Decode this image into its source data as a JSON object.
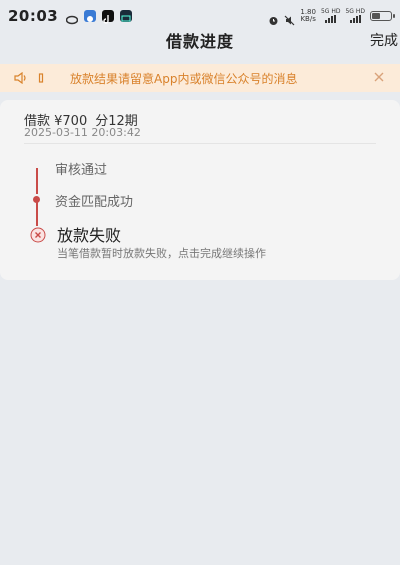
{
  "status_bar": {
    "time": "20:03",
    "net_speed_value": "1.80",
    "net_speed_unit": "KB/s",
    "signal_1_label": "5G HD",
    "signal_2_label": "5G HD"
  },
  "nav": {
    "title": "借款进度",
    "done_label": "完成"
  },
  "notice": {
    "text": "放款结果请留意App内或微信公众号的消息"
  },
  "loan": {
    "amount_label": "借款 ¥700",
    "term_label": "分12期",
    "date": "2025-03-11 20:03:42"
  },
  "timeline": {
    "step1": "审核通过",
    "step2": "资金匹配成功",
    "fail_title": "放款失败",
    "fail_desc": "当笔借款暂时放款失败，点击完成继续操作"
  },
  "colors": {
    "accent": "#c94b48",
    "notice_bg": "#fcebd9",
    "notice_text": "#d9822b",
    "page_bg": "#e8ebef"
  }
}
